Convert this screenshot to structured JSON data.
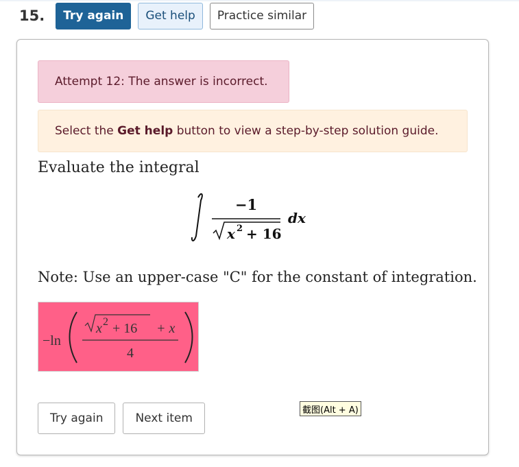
{
  "question": {
    "number": "15.",
    "buttons": {
      "try_again": "Try again",
      "get_help": "Get help",
      "practice_similar": "Practice similar"
    }
  },
  "feedback": {
    "attempt": "Attempt 12: The answer is incorrect.",
    "help_before": "Select the ",
    "help_bold": "Get help",
    "help_after": " button to view a step-by-step solution guide."
  },
  "prompt": {
    "text": "Evaluate the integral",
    "integral": {
      "numerator": "−1",
      "radicand_base": "x",
      "radicand_exp": "2",
      "radicand_rest": "+ 16",
      "differential": "dx"
    },
    "note": "Note: Use an upper-case \"C\" for the constant of integration."
  },
  "answer": {
    "neg_ln": "−ln",
    "radicand_base": "x",
    "radicand_exp": "2",
    "radicand_rest": "+ 16",
    "plus_x": "+ x",
    "denominator": "4",
    "status": "incorrect"
  },
  "footer": {
    "try_again": "Try again",
    "next_item": "Next item"
  },
  "tooltip": "截图(Alt + A)",
  "colors": {
    "primary": "#1e6397",
    "error_bg": "#f5cfdb",
    "info_bg": "#fff1e0",
    "answer_bg": "#ff6088"
  }
}
